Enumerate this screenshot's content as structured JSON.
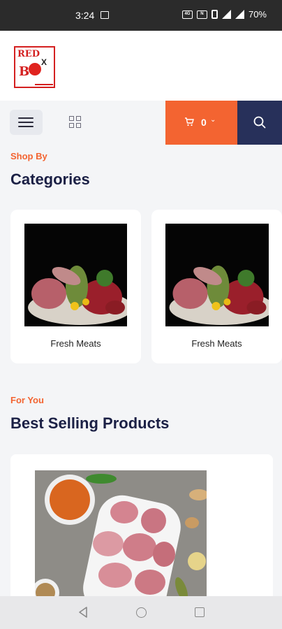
{
  "status_bar": {
    "time": "3:24",
    "battery": "70%",
    "icons": [
      "image-notification-icon",
      "data-icon",
      "nfc-icon",
      "vibrate-icon",
      "wifi-4g-icon",
      "signal-icon"
    ]
  },
  "header": {
    "logo_text_top": "RED",
    "logo_text_b": "B",
    "logo_text_x": "X"
  },
  "toolbar": {
    "cart_count": "0",
    "cart_caret": "⌄"
  },
  "categories_section": {
    "eyebrow": "Shop By",
    "title": "Categories",
    "items": [
      {
        "label": "Fresh Meats"
      },
      {
        "label": "Fresh Meats"
      }
    ]
  },
  "products_section": {
    "eyebrow": "For You",
    "title": "Best Selling Products"
  },
  "colors": {
    "accent": "#f36431",
    "navy": "#27305a",
    "heading": "#1b2045",
    "background": "#f4f5f7"
  }
}
